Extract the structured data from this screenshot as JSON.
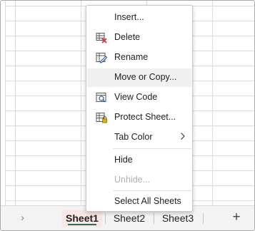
{
  "context_menu": {
    "items": [
      {
        "label": "Insert...",
        "icon": null
      },
      {
        "label": "Delete",
        "icon": "delete-sheet-icon"
      },
      {
        "label": "Rename",
        "icon": "rename-icon"
      },
      {
        "label": "Move or Copy...",
        "icon": null,
        "highlighted": true
      },
      {
        "label": "View Code",
        "icon": "view-code-icon"
      },
      {
        "label": "Protect Sheet...",
        "icon": "protect-sheet-icon"
      },
      {
        "label": "Tab Color",
        "icon": null,
        "submenu": true
      },
      {
        "label": "Hide",
        "icon": null
      },
      {
        "label": "Unhide...",
        "icon": null,
        "disabled": true
      },
      {
        "label": "Select All Sheets",
        "icon": null
      }
    ]
  },
  "sheet_tabs": {
    "nav_arrow": "›",
    "tabs": [
      "Sheet1",
      "Sheet2",
      "Sheet3"
    ],
    "active_index": 0,
    "add_label": "+"
  },
  "colors": {
    "accent_green": "#217346",
    "active_tab_bg": "#f9e6e6",
    "menu_highlight": "#f0f0f0",
    "disabled_text": "#b0b0b0"
  }
}
